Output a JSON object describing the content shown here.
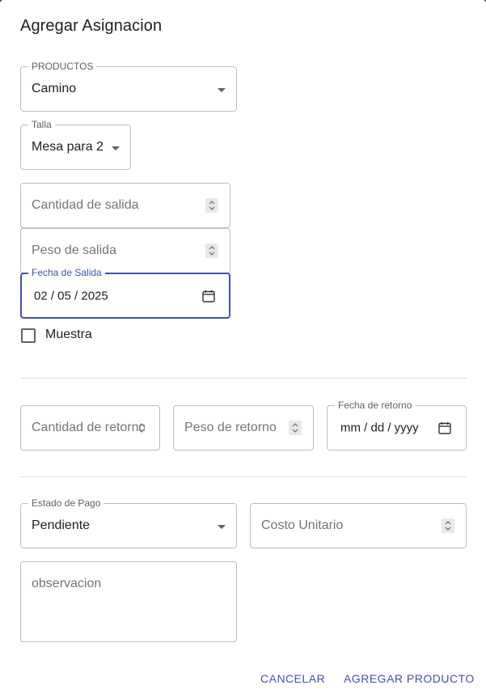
{
  "dialog": {
    "title": "Agregar Asignacion"
  },
  "productos": {
    "label": "PRODUCTOS",
    "value": "Camino"
  },
  "talla": {
    "label": "Talla",
    "value": "Mesa para 2"
  },
  "cantidad_salida": {
    "placeholder": "Cantidad de salida"
  },
  "peso_salida": {
    "placeholder": "Peso de salida"
  },
  "fecha_salida": {
    "label": "Fecha de Salida",
    "value": "02 / 05 / 2025"
  },
  "muestra": {
    "label": "Muestra",
    "checked": false
  },
  "cantidad_retorno": {
    "placeholder": "Cantidad de retorno"
  },
  "peso_retorno": {
    "placeholder": "Peso de retorno"
  },
  "fecha_retorno": {
    "label": "Fecha de retorno",
    "value": "mm / dd / yyyy"
  },
  "estado_pago": {
    "label": "Estado de Pago",
    "value": "Pendiente"
  },
  "costo_unitario": {
    "placeholder": "Costo Unitario"
  },
  "observacion": {
    "placeholder": "observacion"
  },
  "actions": {
    "cancel": "CANCELAR",
    "submit": "AGREGAR PRODUCTO"
  },
  "colors": {
    "primary": "#3f51b5",
    "border": "#bdbdbd",
    "backdrop": "#2f3337"
  },
  "icons": {
    "select_caret": "caret-down-icon",
    "number_spinner": "spinner-arrows-icon",
    "date_picker": "calendar-icon"
  }
}
